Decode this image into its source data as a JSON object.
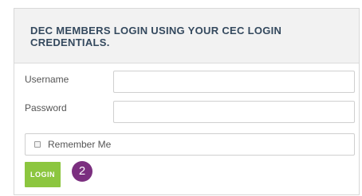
{
  "login_form": {
    "title": "DEC MEMBERS LOGIN USING YOUR CEC LOGIN CREDENTIALS.",
    "username_label": "Username",
    "username_value": "",
    "password_label": "Password",
    "password_value": "",
    "remember_label": "Remember Me",
    "remember_checked": false,
    "login_button_label": "LOGIN",
    "step_badge": "2",
    "colors": {
      "title": "#34495e",
      "header_background": "#f2f2f2",
      "login_button": "#8cc63f",
      "step_badge": "#7b2f7f"
    }
  }
}
